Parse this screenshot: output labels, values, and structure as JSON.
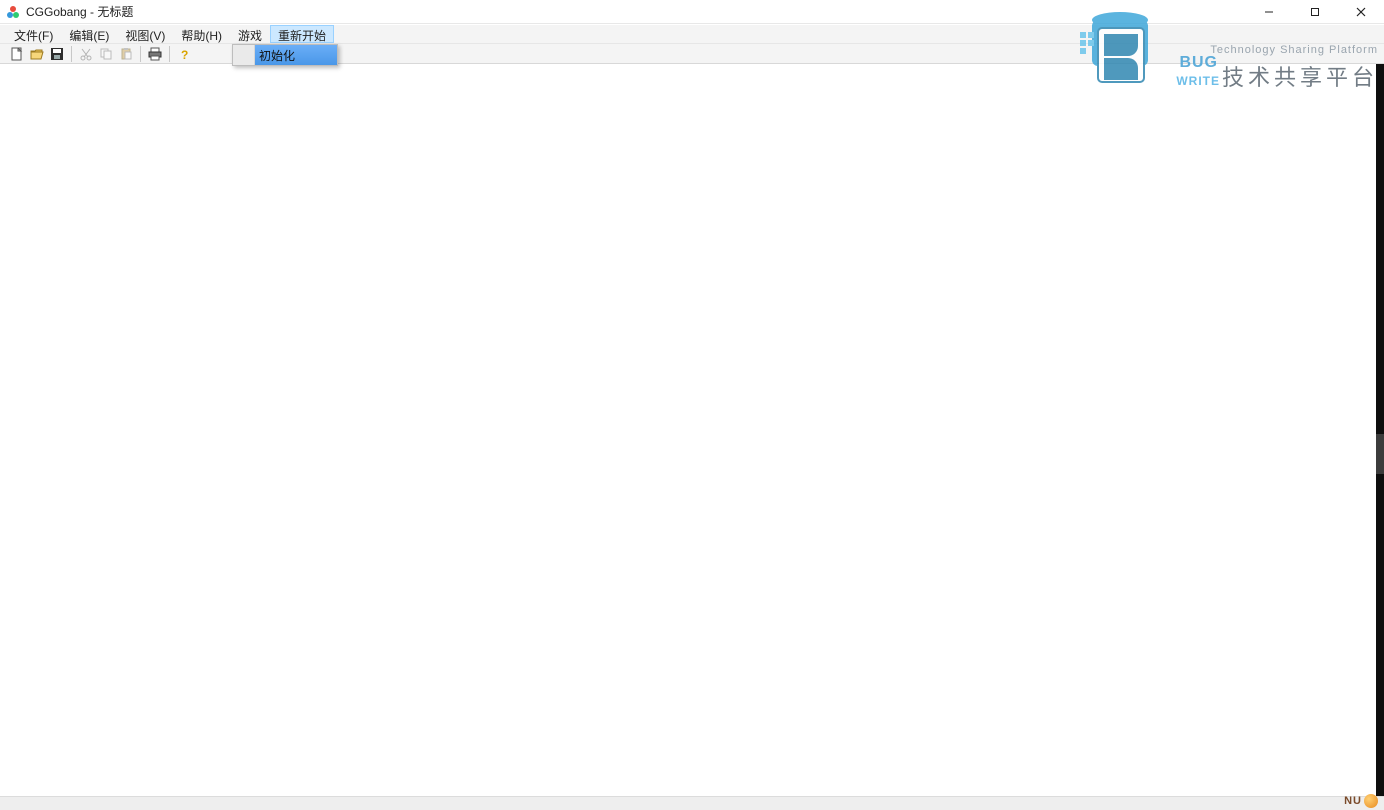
{
  "window": {
    "title": "CGGobang - 无标题"
  },
  "menubar": {
    "items": [
      {
        "label": "文件(F)"
      },
      {
        "label": "编辑(E)"
      },
      {
        "label": "视图(V)"
      },
      {
        "label": "帮助(H)"
      },
      {
        "label": "游戏"
      },
      {
        "label": "重新开始",
        "selected": true
      }
    ]
  },
  "dropdown": {
    "items": [
      {
        "label": "初始化"
      }
    ]
  },
  "toolbar": {
    "icons": [
      "new",
      "open",
      "save",
      "|",
      "cut",
      "copy",
      "paste",
      "|",
      "print",
      "|",
      "help"
    ]
  },
  "watermark": {
    "tagline": "Technology Sharing Platform",
    "cn": "技术共享平台",
    "bug": "BUG",
    "write": "WRITE",
    "corner": "NU"
  }
}
